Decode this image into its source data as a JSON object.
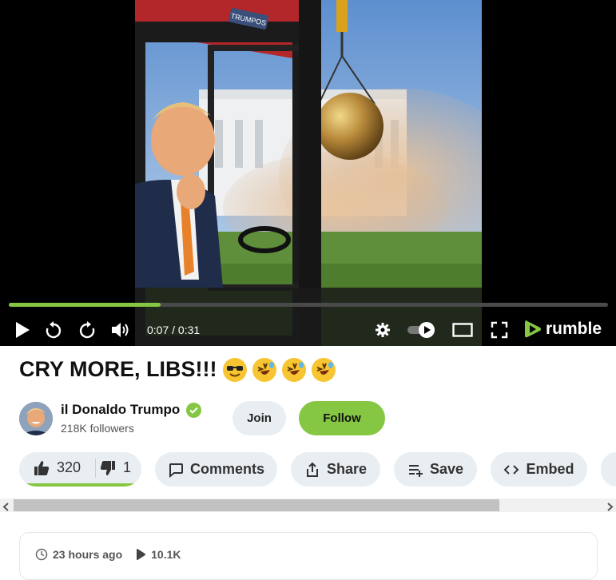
{
  "player": {
    "time": "0:07 / 0:31",
    "progress": 0.253,
    "brand": "rumble",
    "cab_sign": "TRUMPOS"
  },
  "video": {
    "title": "CRY MORE, LIBS!!!",
    "emojis": [
      "smiling-face-with-sunglasses",
      "rolling-on-the-floor-laughing",
      "rolling-on-the-floor-laughing",
      "rolling-on-the-floor-laughing"
    ]
  },
  "channel": {
    "name": "il Donaldo Trumpo",
    "followers": "218K followers",
    "join_label": "Join",
    "follow_label": "Follow"
  },
  "actions": {
    "likes": "320",
    "dislikes": "1",
    "comments_label": "Comments",
    "share_label": "Share",
    "save_label": "Save",
    "embed_label": "Embed"
  },
  "meta": {
    "posted": "23 hours ago",
    "views": "10.1K"
  },
  "colors": {
    "accent": "#85c742",
    "pill_bg": "#e9eef2"
  }
}
